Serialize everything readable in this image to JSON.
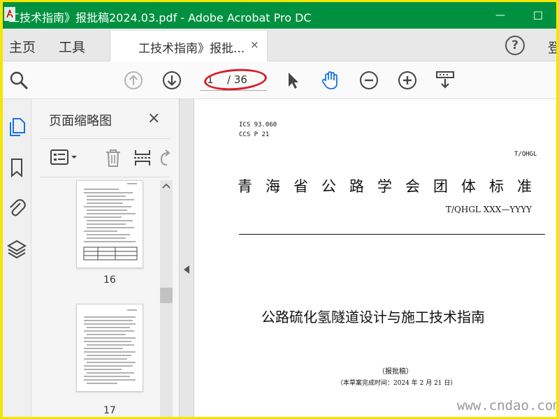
{
  "window": {
    "title": "工技术指南》报批稿2024.03.pdf - Adobe Acrobat Pro DC",
    "minimize_glyph": "—",
    "maximize_glyph": "☐"
  },
  "menu": {
    "home": "主页",
    "tools": "工具",
    "document_tab": "工技术指南》报批...",
    "tab_close": "×",
    "help": "?",
    "login_clip": "登"
  },
  "toolbar": {
    "current_page": "1",
    "total_pages": "/ 36",
    "icons": [
      "zoom-search-icon",
      "prev-page-icon",
      "next-page-icon",
      "select-cursor-icon",
      "hand-tool-icon",
      "zoom-out-icon",
      "zoom-in-icon",
      "scroll-mode-icon"
    ],
    "accent_color": "#1473e6",
    "annotation_color": "#d6202a"
  },
  "nav_strip": {
    "icons": [
      "page-thumbnails-icon",
      "bookmark-icon",
      "attachment-icon",
      "layers-icon"
    ]
  },
  "thumbnails_panel": {
    "title": "页面缩略图",
    "close": "×",
    "pages": [
      {
        "number": "16"
      },
      {
        "number": "17"
      }
    ]
  },
  "document": {
    "ics": "ICS  93.060",
    "ccs": "CCS  P  21",
    "org_code": "T/QHGL",
    "standard_title": "青海省公路学会团体标准",
    "standard_number": "T/QHGL XXX—YYYY",
    "main_title": "公路硫化氢隧道设计与施工技术指南",
    "status": "（报批稿）",
    "completion_date": "（本草案完成时间：2024 年 2 月 21 日）"
  },
  "watermark": "www.cndao.com",
  "colors": {
    "titlebar": "#009140",
    "frame_border": "#f4e600"
  }
}
